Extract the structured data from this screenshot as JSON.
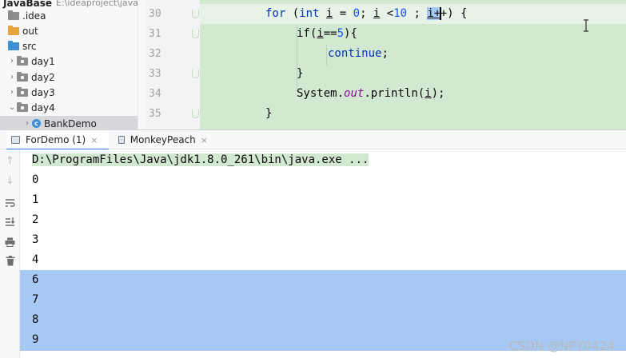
{
  "project_tree": {
    "project_name": "JavaBase",
    "project_path": "E:\\ideaproject\\javab",
    "items": [
      {
        "label": ".idea",
        "type": "folder-gray",
        "arrow": "",
        "indent": 0
      },
      {
        "label": "out",
        "type": "folder-orange",
        "arrow": "",
        "indent": 0
      },
      {
        "label": "src",
        "type": "folder-blue",
        "arrow": "",
        "indent": 0
      },
      {
        "label": "day1",
        "type": "package",
        "arrow": "›",
        "indent": 1
      },
      {
        "label": "day2",
        "type": "package",
        "arrow": "›",
        "indent": 1
      },
      {
        "label": "day3",
        "type": "package",
        "arrow": "›",
        "indent": 1
      },
      {
        "label": "day4",
        "type": "package",
        "arrow": "⌄",
        "indent": 1
      },
      {
        "label": "BankDemo",
        "type": "class",
        "arrow": "›",
        "indent": 2
      }
    ]
  },
  "editor": {
    "line_numbers": [
      "30",
      "31",
      "32",
      "33",
      "34",
      "35"
    ],
    "lines": {
      "l30": {
        "kw_for": "for",
        "p1": " (",
        "kw_int": "int",
        "s1": " ",
        "var_i1": "i",
        "s2": " = ",
        "n0": "0",
        "s3": "; ",
        "var_i2": "i",
        "s4": " <",
        "n10": "10",
        "s5": " ; ",
        "var_i3": "i+",
        "s6": "+",
        "s7": ") {"
      },
      "l31": {
        "kw_if": "if",
        "p1": "(",
        "var_i": "i",
        "p2": "==",
        "n5": "5",
        "p3": "){"
      },
      "l32": {
        "kw_continue": "continue",
        "p1": ";"
      },
      "l33": {
        "text": "}"
      },
      "l34": {
        "sys": "System.",
        "field_out": "out",
        "mid": ".println(",
        "var_i": "i",
        "end": ");"
      },
      "l35": {
        "text": "}"
      }
    }
  },
  "run_panel": {
    "tabs": [
      {
        "label": "ForDemo (1)",
        "close": "×",
        "active": true
      },
      {
        "label": "MonkeyPeach",
        "close": "×",
        "active": false
      }
    ],
    "toolbar_icons": [
      "up-arrow-icon",
      "down-arrow-icon",
      "soft-wrap-icon",
      "scroll-to-end-icon",
      "print-icon",
      "trash-icon"
    ],
    "command": "D:\\ProgramFiles\\Java\\jdk1.8.0_261\\bin\\java.exe ...",
    "output": [
      "0",
      "1",
      "2",
      "3",
      "4",
      "6",
      "7",
      "8",
      "9"
    ],
    "selected_from_index": 5
  },
  "watermark": "CSDN @NFY0424",
  "colors": {
    "code_background": "#d2e8d1",
    "selection": "#a6c9f3",
    "keyword": "#0033b3",
    "number": "#1750eb",
    "field": "#871094"
  }
}
